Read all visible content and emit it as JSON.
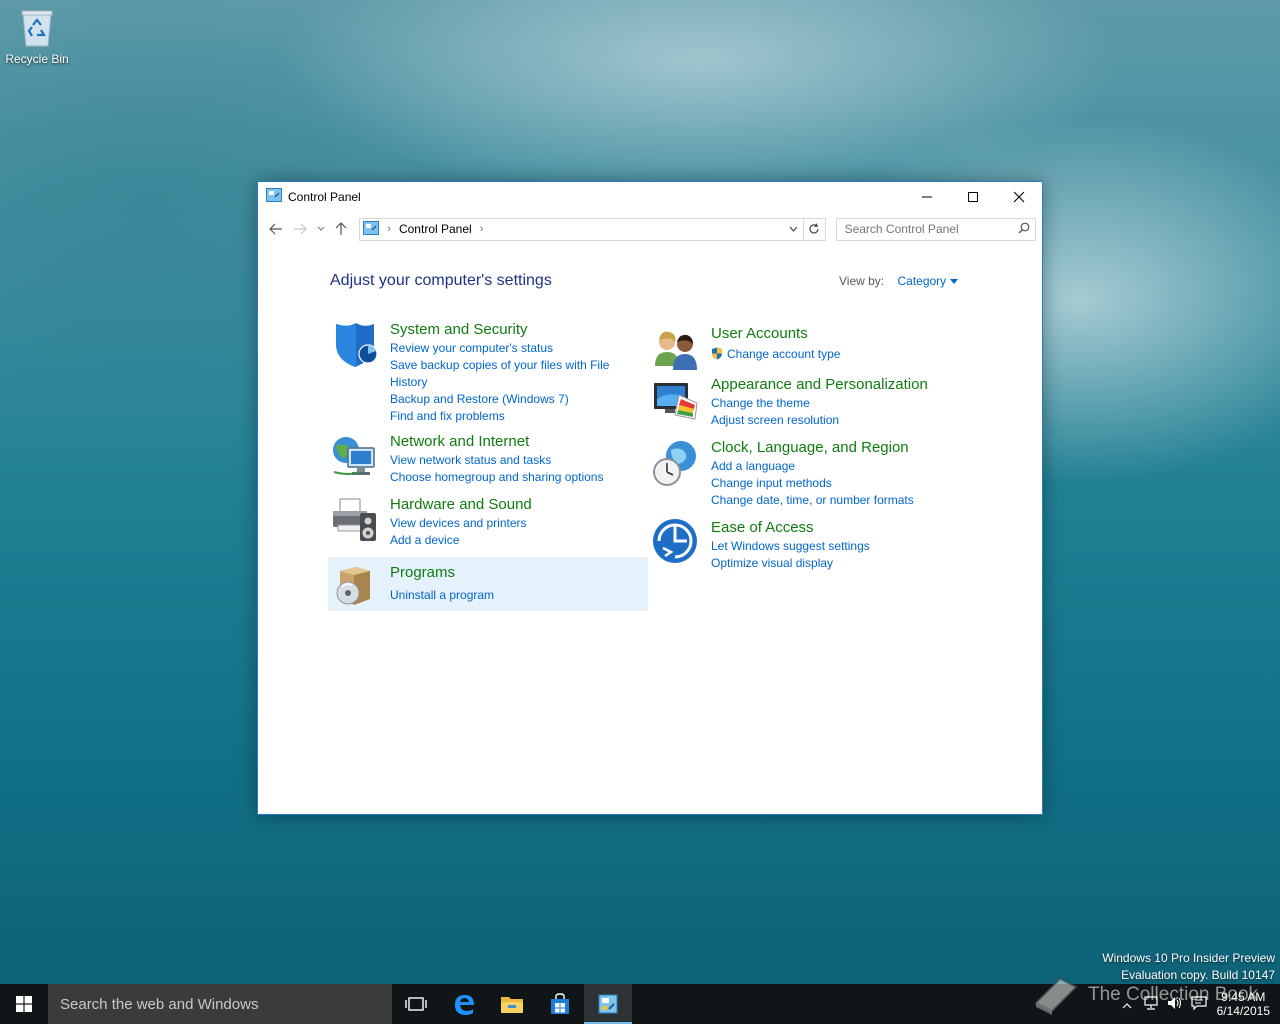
{
  "desktop": {
    "recycle_bin_label": "Recycle Bin",
    "watermark_line1": "Windows 10 Pro Insider Preview",
    "watermark_line2": "Evaluation copy. Build 10147",
    "overlay_text": "The Collection Book"
  },
  "window": {
    "title": "Control Panel",
    "address_crumb": "Control Panel",
    "search_placeholder": "Search Control Panel",
    "heading": "Adjust your computer's settings",
    "view_by_label": "View by:",
    "view_by_value": "Category",
    "categories": [
      {
        "title": "System and Security",
        "icon": "shield-icon",
        "links": [
          "Review your computer's status",
          "Save backup copies of your files with File",
          "History",
          "Backup and Restore (Windows 7)",
          "Find and fix problems"
        ]
      },
      {
        "title": "Network and Internet",
        "icon": "network-icon",
        "links": [
          "View network status and tasks",
          "Choose homegroup and sharing options"
        ]
      },
      {
        "title": "Hardware and Sound",
        "icon": "printer-icon",
        "links": [
          "View devices and printers",
          "Add a device"
        ]
      },
      {
        "title": "Programs",
        "icon": "programs-icon",
        "links": [
          "Uninstall a program"
        ]
      },
      {
        "title": "User Accounts",
        "icon": "users-icon",
        "links": [
          "Change account type"
        ]
      },
      {
        "title": "Appearance and Personalization",
        "icon": "monitor-palette-icon",
        "links": [
          "Change the theme",
          "Adjust screen resolution"
        ]
      },
      {
        "title": "Clock, Language, and Region",
        "icon": "clock-globe-icon",
        "links": [
          "Add a language",
          "Change input methods",
          "Change date, time, or number formats"
        ]
      },
      {
        "title": "Ease of Access",
        "icon": "ease-of-access-icon",
        "links": [
          "Let Windows suggest settings",
          "Optimize visual display"
        ]
      }
    ]
  },
  "taskbar": {
    "search_placeholder": "Search the web and Windows",
    "time": "9:45 AM",
    "date": "6/14/2015"
  },
  "colors": {
    "link": "#0066cc",
    "category_title": "#107c10",
    "heading": "#1e3287",
    "accent": "#2b79c4"
  }
}
